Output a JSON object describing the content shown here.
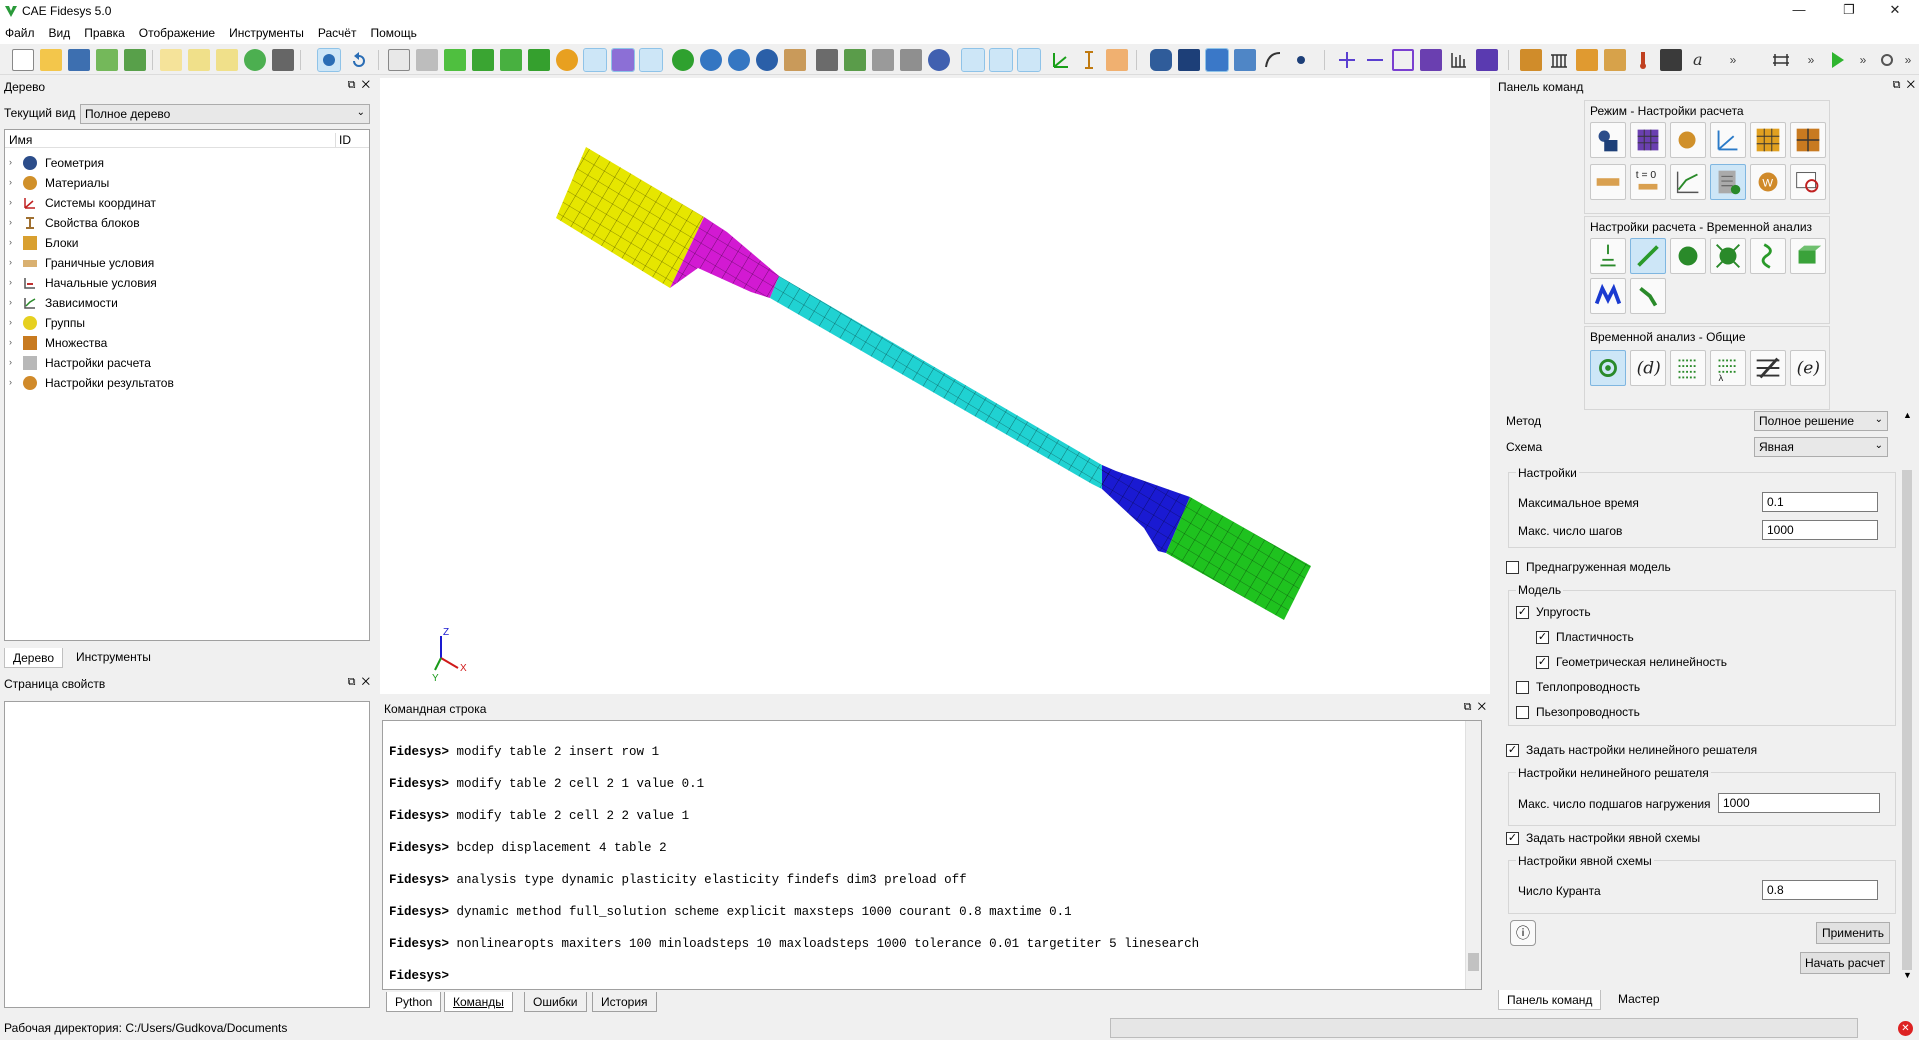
{
  "window": {
    "title": "CAE Fidesys 5.0",
    "min": "—",
    "max": "❐",
    "close": "✕"
  },
  "menu": [
    "Файл",
    "Вид",
    "Правка",
    "Отображение",
    "Инструменты",
    "Расчёт",
    "Помощь"
  ],
  "tree_panel": {
    "title": "Дерево",
    "current_view_label": "Текущий вид",
    "current_view_value": "Полное дерево",
    "col_name": "Имя",
    "col_id": "ID",
    "items": [
      {
        "label": "Геометрия",
        "icon": "geometry-icon"
      },
      {
        "label": "Материалы",
        "icon": "materials-icon"
      },
      {
        "label": "Системы координат",
        "icon": "coordinate-systems-icon"
      },
      {
        "label": "Свойства блоков",
        "icon": "block-properties-icon"
      },
      {
        "label": "Блоки",
        "icon": "blocks-icon"
      },
      {
        "label": "Граничные условия",
        "icon": "boundary-conditions-icon"
      },
      {
        "label": "Начальные условия",
        "icon": "initial-conditions-icon"
      },
      {
        "label": "Зависимости",
        "icon": "dependencies-icon"
      },
      {
        "label": "Группы",
        "icon": "groups-icon"
      },
      {
        "label": "Множества",
        "icon": "sets-icon"
      },
      {
        "label": "Настройки расчета",
        "icon": "analysis-settings-icon"
      },
      {
        "label": "Настройки результатов",
        "icon": "results-settings-icon"
      }
    ],
    "tabs": [
      "Дерево",
      "Инструменты"
    ]
  },
  "properties_panel": {
    "title": "Страница свойств"
  },
  "console": {
    "title": "Командная строка",
    "prompt": "Fidesys>",
    "lines": [
      "modify table 2 insert row 1",
      "modify table 2 cell 2 1 value 0.1",
      "modify table 2 cell 2 2 value 1",
      "bcdep displacement 4 table 2",
      "analysis type dynamic plasticity elasticity findefs dim3 preload off",
      "dynamic method full_solution scheme explicit maxsteps 1000 courant 0.8 maxtime 0.1",
      "nonlinearopts maxiters 100 minloadsteps 10 maxloadsteps 1000 tolerance 0.01 targetiter 5 linesearch",
      ""
    ],
    "tabs": [
      "Python",
      "Команды",
      "Ошибки",
      "История"
    ]
  },
  "axes": {
    "z": "Z",
    "x": "X",
    "y": "Y"
  },
  "command_panel": {
    "title": "Панель команд",
    "mode_title": "Режим - Настройки расчета",
    "analysis_title": "Настройки расчета - Временной анализ",
    "general_title": "Временной анализ - Общие",
    "t0_label": "t = 0",
    "method_label": "Метод",
    "method_value": "Полное решение",
    "scheme_label": "Схема",
    "scheme_value": "Явная",
    "settings_group": "Настройки",
    "max_time_label": "Максимальное время",
    "max_time_value": "0.1",
    "max_steps_label": "Макс. число шагов",
    "max_steps_value": "1000",
    "preloaded_label": "Преднагруженная модель",
    "preloaded": false,
    "model_group": "Модель",
    "elasticity_label": "Упругость",
    "elasticity": true,
    "plasticity_label": "Пластичность",
    "plasticity": true,
    "geom_nonlin_label": "Геометрическая нелинейность",
    "geom_nonlin": true,
    "heat_label": "Теплопроводность",
    "heat": false,
    "piezo_label": "Пьезопроводность",
    "piezo": false,
    "nonlin_solver_chk_label": "Задать настройки нелинейного решателя",
    "nonlin_solver_chk": true,
    "nonlin_solver_group": "Настройки нелинейного решателя",
    "max_substeps_label": "Макс. число подшагов нагружения",
    "max_substeps_value": "1000",
    "explicit_chk_label": "Задать настройки явной схемы",
    "explicit_chk": true,
    "explicit_group": "Настройки явной схемы",
    "courant_label": "Число Куранта",
    "courant_value": "0.8",
    "apply_label": "Применить",
    "start_label": "Начать расчет",
    "tabs": [
      "Панель команд",
      "Мастер"
    ]
  },
  "statusbar": {
    "workdir": "Рабочая директория: C:/Users/Gudkova/Documents"
  },
  "colors": {
    "grip_left": "#e6e600",
    "transition_left": "#d21ad2",
    "gauge": "#20d2d2",
    "transition_right": "#1a1ad2",
    "grip_right": "#1fc21f",
    "selected": "#cde6f7"
  }
}
